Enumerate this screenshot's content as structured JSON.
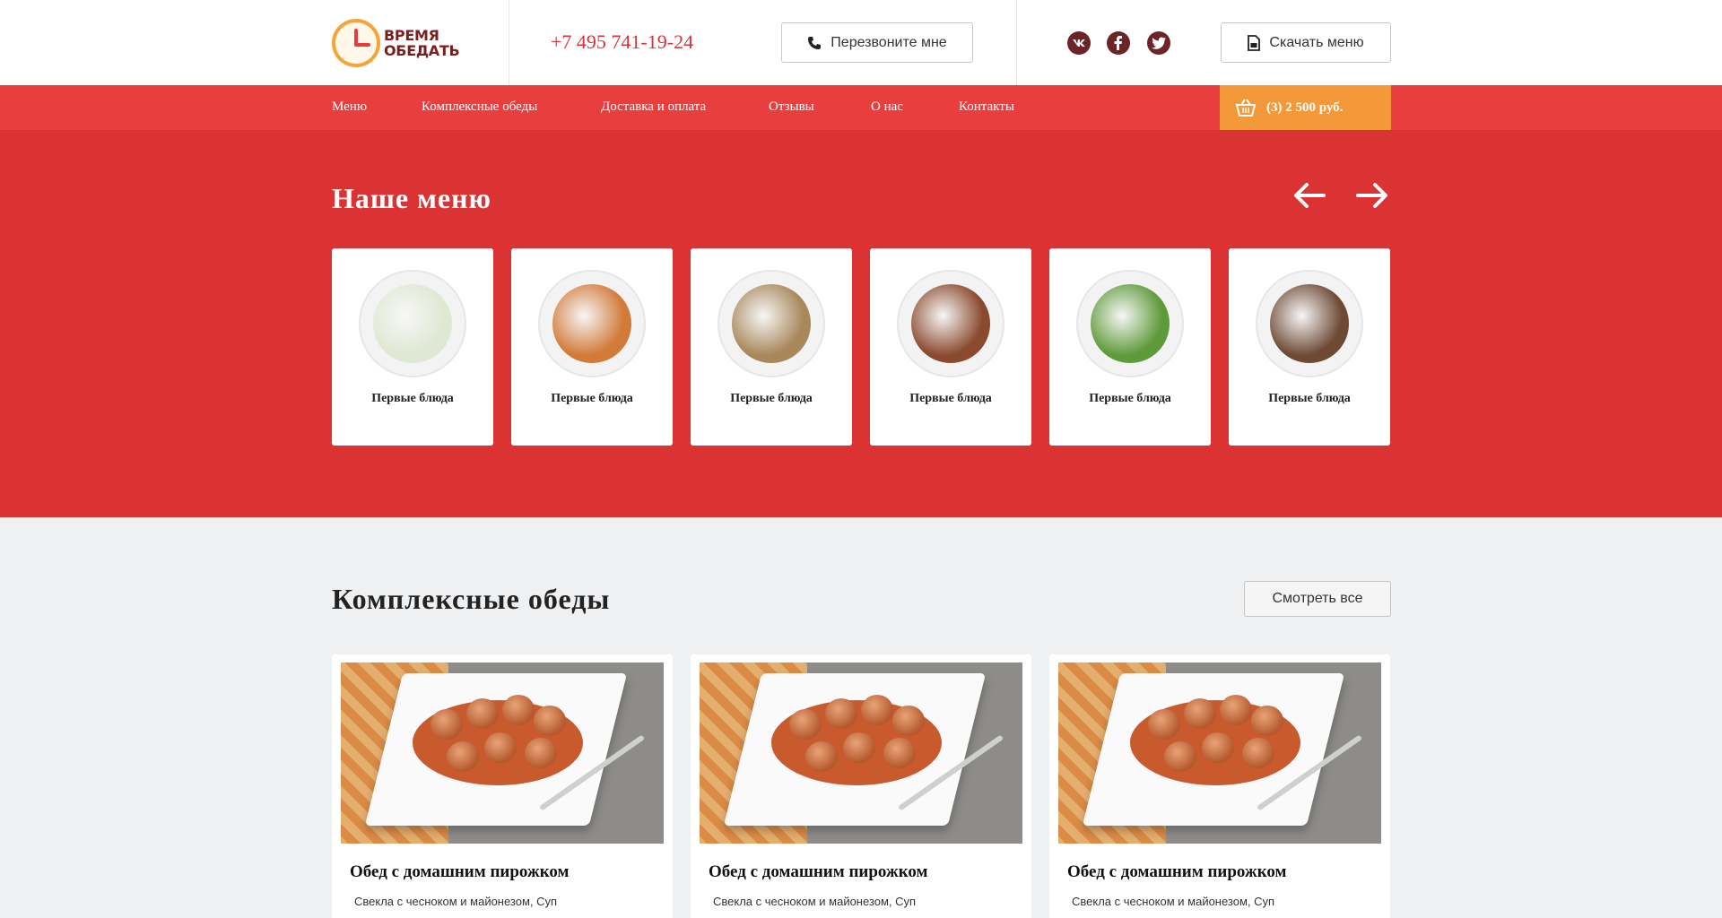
{
  "header": {
    "logo": {
      "line1": "ВРЕМЯ",
      "line2": "ОБЕДАТЬ"
    },
    "phone": {
      "prefix": "+7 495",
      "number": "741-19-24"
    },
    "callback_label": "Перезвоните мне",
    "download_label": "Скачать меню",
    "social": [
      {
        "icon": "vk-icon",
        "glyph": "vk"
      },
      {
        "icon": "facebook-icon",
        "glyph": "f"
      },
      {
        "icon": "twitter-icon",
        "glyph": "t"
      }
    ]
  },
  "nav": {
    "items": [
      "Меню",
      "Комплексные обеды",
      "Доставка и оплата",
      "Отзывы",
      "О нас",
      "Контакты"
    ],
    "cart_label": "(3) 2 500 руб."
  },
  "menu_section": {
    "title": "Наше меню",
    "cards": [
      {
        "label": "Первые блюда",
        "food_color": "#dfe8d2"
      },
      {
        "label": "Первые блюда",
        "food_color": "#d27a38"
      },
      {
        "label": "Первые блюда",
        "food_color": "#a8875a"
      },
      {
        "label": "Первые блюда",
        "food_color": "#8a4a2e"
      },
      {
        "label": "Первые блюда",
        "food_color": "#5f9a3a"
      },
      {
        "label": "Первые блюда",
        "food_color": "#6e4a35"
      }
    ]
  },
  "lunch_section": {
    "title": "Комплексные обеды",
    "view_all_label": "Смотреть все",
    "cards": [
      {
        "title": "Обед с домашним пирожком",
        "desc": "Свекла с чесноком и майонезом, Суп"
      },
      {
        "title": "Обед с домашним пирожком",
        "desc": "Свекла с чесноком и майонезом, Суп"
      },
      {
        "title": "Обед с домашним пирожком",
        "desc": "Свекла с чесноком и майонезом, Суп"
      }
    ]
  },
  "colors": {
    "nav_red": "#e93e3e",
    "section_red": "#db3333",
    "cart_orange": "#f4993a",
    "phone_red": "#d7333b"
  }
}
